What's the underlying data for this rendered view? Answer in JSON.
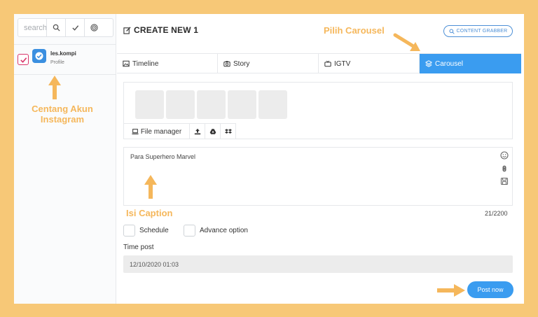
{
  "sidebar": {
    "search": {
      "placeholder": "search"
    },
    "account": {
      "name": "les.kompi",
      "type": "Profile"
    }
  },
  "header": {
    "title": "CREATE NEW 1",
    "grabber_label": "CONTENT GRABBER"
  },
  "tabs": [
    {
      "label": "Timeline",
      "icon": "image-icon"
    },
    {
      "label": "Story",
      "icon": "camera-icon"
    },
    {
      "label": "IGTV",
      "icon": "tv-icon"
    },
    {
      "label": "Carousel",
      "icon": "layers-icon",
      "active": true
    }
  ],
  "media": {
    "file_manager_label": "File manager"
  },
  "caption": {
    "value": "Para Superhero Marvel",
    "counter": "21/2200"
  },
  "options": {
    "schedule_label": "Schedule",
    "advance_label": "Advance option"
  },
  "time_post": {
    "label": "Time post",
    "value": "12/10/2020 01:03"
  },
  "post_button": "Post now",
  "annotations": {
    "carousel": "Pilih Carousel",
    "account_line1": "Centang Akun",
    "account_line2": "Instagram",
    "caption": "Isi Caption"
  },
  "colors": {
    "frame": "#f7c877",
    "accent": "#3a9cf0",
    "annotation": "#f5b75b",
    "check": "#d9366b"
  }
}
